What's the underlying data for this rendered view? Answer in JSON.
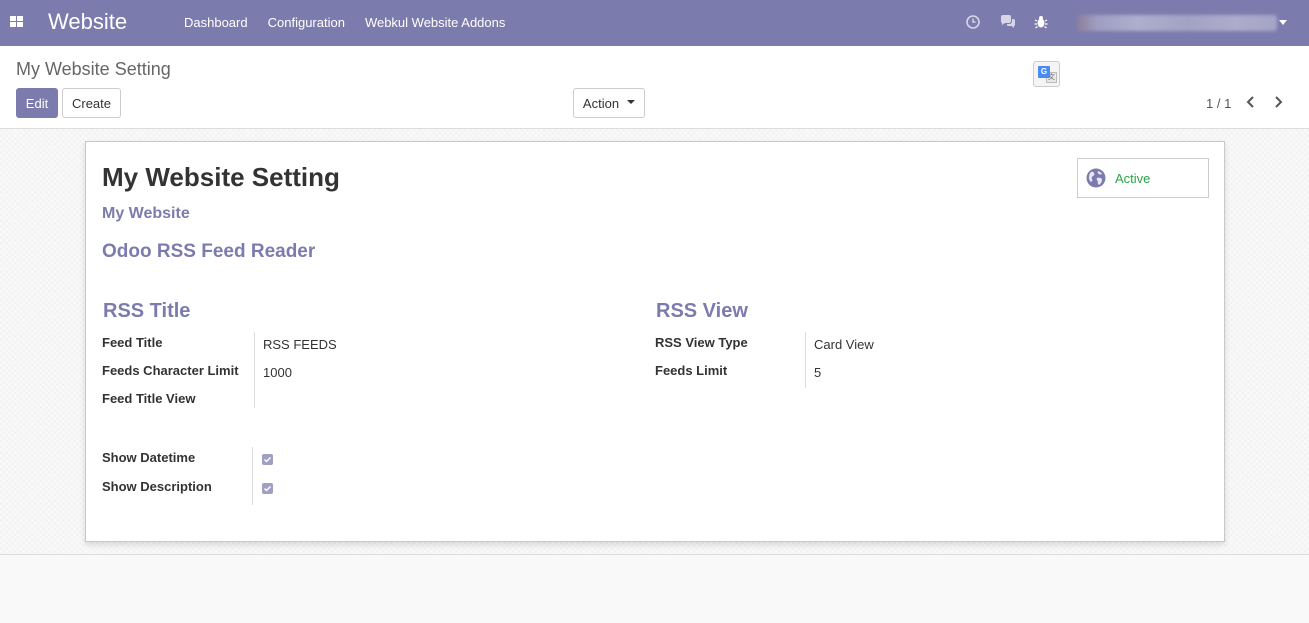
{
  "navbar": {
    "brand": "Website",
    "menu": [
      "Dashboard",
      "Configuration",
      "Webkul Website Addons"
    ]
  },
  "control": {
    "breadcrumb": "My Website Setting",
    "edit_label": "Edit",
    "create_label": "Create",
    "action_label": "Action",
    "pager": "1 / 1"
  },
  "form": {
    "status": "Active",
    "title": "My Website Setting",
    "website": "My Website",
    "module_name": "Odoo RSS Feed Reader",
    "rss_title": {
      "heading": "RSS Title",
      "feed_title_label": "Feed Title",
      "feed_title_value": "RSS FEEDS",
      "char_limit_label": "Feeds Character Limit",
      "char_limit_value": "1000",
      "title_view_label": "Feed Title View"
    },
    "rss_view": {
      "heading": "RSS View",
      "view_type_label": "RSS View Type",
      "view_type_value": "Card View",
      "feeds_limit_label": "Feeds Limit",
      "feeds_limit_value": "5"
    },
    "show_datetime_label": "Show Datetime",
    "show_datetime": true,
    "show_description_label": "Show Description",
    "show_description": true
  },
  "colors": {
    "primary": "#7c7bad",
    "success": "#28a745"
  }
}
